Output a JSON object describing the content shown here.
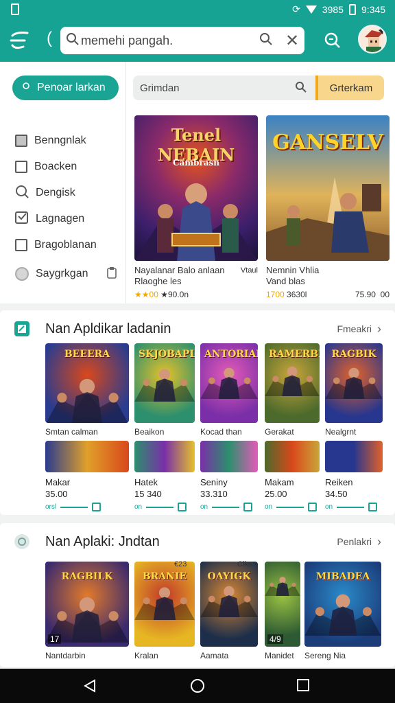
{
  "status": {
    "time": "9:345",
    "signal_text": "3985"
  },
  "search": {
    "query": "memehi pangah."
  },
  "sidebar": {
    "primary_button": "Penoar larkan",
    "items": [
      {
        "label": "Benngnlak",
        "icon": "square-filled"
      },
      {
        "label": "Boacken",
        "icon": "square"
      },
      {
        "label": "Dengisk",
        "icon": "search-circle"
      },
      {
        "label": "Lagnagen",
        "icon": "square-check"
      },
      {
        "label": "Bragoblanan",
        "icon": "square"
      },
      {
        "label": "Saygrkgan",
        "icon": "circle"
      }
    ]
  },
  "featured": {
    "search_placeholder": "Grimdan",
    "button_label": "Grterkam",
    "cards": [
      {
        "art_title": "Tenel NEBAIN",
        "art_sub": "Cambrasn",
        "title": "Nayalanar Balo anlaan",
        "subtitle": "Rlaoghe les",
        "badge": "Vtaul",
        "rating": "★★00",
        "price": "★90.0n",
        "colors": [
          "#3b1f6b",
          "#e3541c"
        ]
      },
      {
        "art_title": "GANSELV",
        "title": "Nemnin Vhlia",
        "subtitle": "Vand blas",
        "rating": "1700",
        "price": "3630l",
        "extra": "75.90",
        "extra2": "00",
        "colors": [
          "#2c6a9e",
          "#e8b24a"
        ]
      }
    ]
  },
  "section1": {
    "title": "Nan Apldikar ladanin",
    "more": "Fmeakri",
    "tiles": [
      {
        "name": "Smtan calman",
        "art_title": "BEEERA",
        "colors": [
          "#2a3c8f",
          "#d9481b"
        ]
      },
      {
        "name": "Beaikon",
        "art_title": "SKJOBAPL",
        "colors": [
          "#2c8f6e",
          "#e5c12a"
        ]
      },
      {
        "name": "Kocad than",
        "art_title": "ANTORIAN",
        "colors": [
          "#7a2fa8",
          "#e45bb8"
        ]
      },
      {
        "name": "Gerakat",
        "art_title": "RAMERBET",
        "colors": [
          "#4c6a2c",
          "#c9a53a"
        ]
      },
      {
        "name": "Nealgrnt",
        "art_title": "RAGBIK",
        "colors": [
          "#27368e",
          "#e2622a"
        ]
      }
    ],
    "items": [
      {
        "name": "Makar",
        "price": "35.00",
        "badge": "orsl"
      },
      {
        "name": "Hatek",
        "price": "15 340",
        "badge": "on"
      },
      {
        "name": "Seniny",
        "price": "33.310",
        "badge": "on"
      },
      {
        "name": "Makam",
        "price": "25.00",
        "badge": "on"
      },
      {
        "name": "Reiken",
        "price": "34.50",
        "badge": "on"
      }
    ]
  },
  "section2": {
    "title": "Nan Aplaki: Jndtan",
    "more": "Penlakri",
    "tiles": [
      {
        "name": "Nantdarbin",
        "art_title": "RAGBILK",
        "badge": "17",
        "colors": [
          "#3a2a6e",
          "#e37a2a"
        ]
      },
      {
        "name": "Kralan",
        "art_title": "BRANIE",
        "top_text": "€23",
        "colors": [
          "#e6b623",
          "#c23a2a"
        ]
      },
      {
        "name": "Aamata",
        "art_title": "OAYIGK",
        "top_text": "Ciks",
        "colors": [
          "#1c2e4a",
          "#d88734"
        ]
      },
      {
        "name": "Manidet",
        "art_title": "",
        "badge": "4/9",
        "colors": [
          "#2d5a32",
          "#9bc243"
        ]
      },
      {
        "name": "Sereng Nia",
        "art_title": "MIBADEA",
        "colors": [
          "#1c3c7a",
          "#2a8ac9"
        ]
      }
    ]
  },
  "nav": {
    "back": "back",
    "home": "home",
    "recents": "recents"
  }
}
